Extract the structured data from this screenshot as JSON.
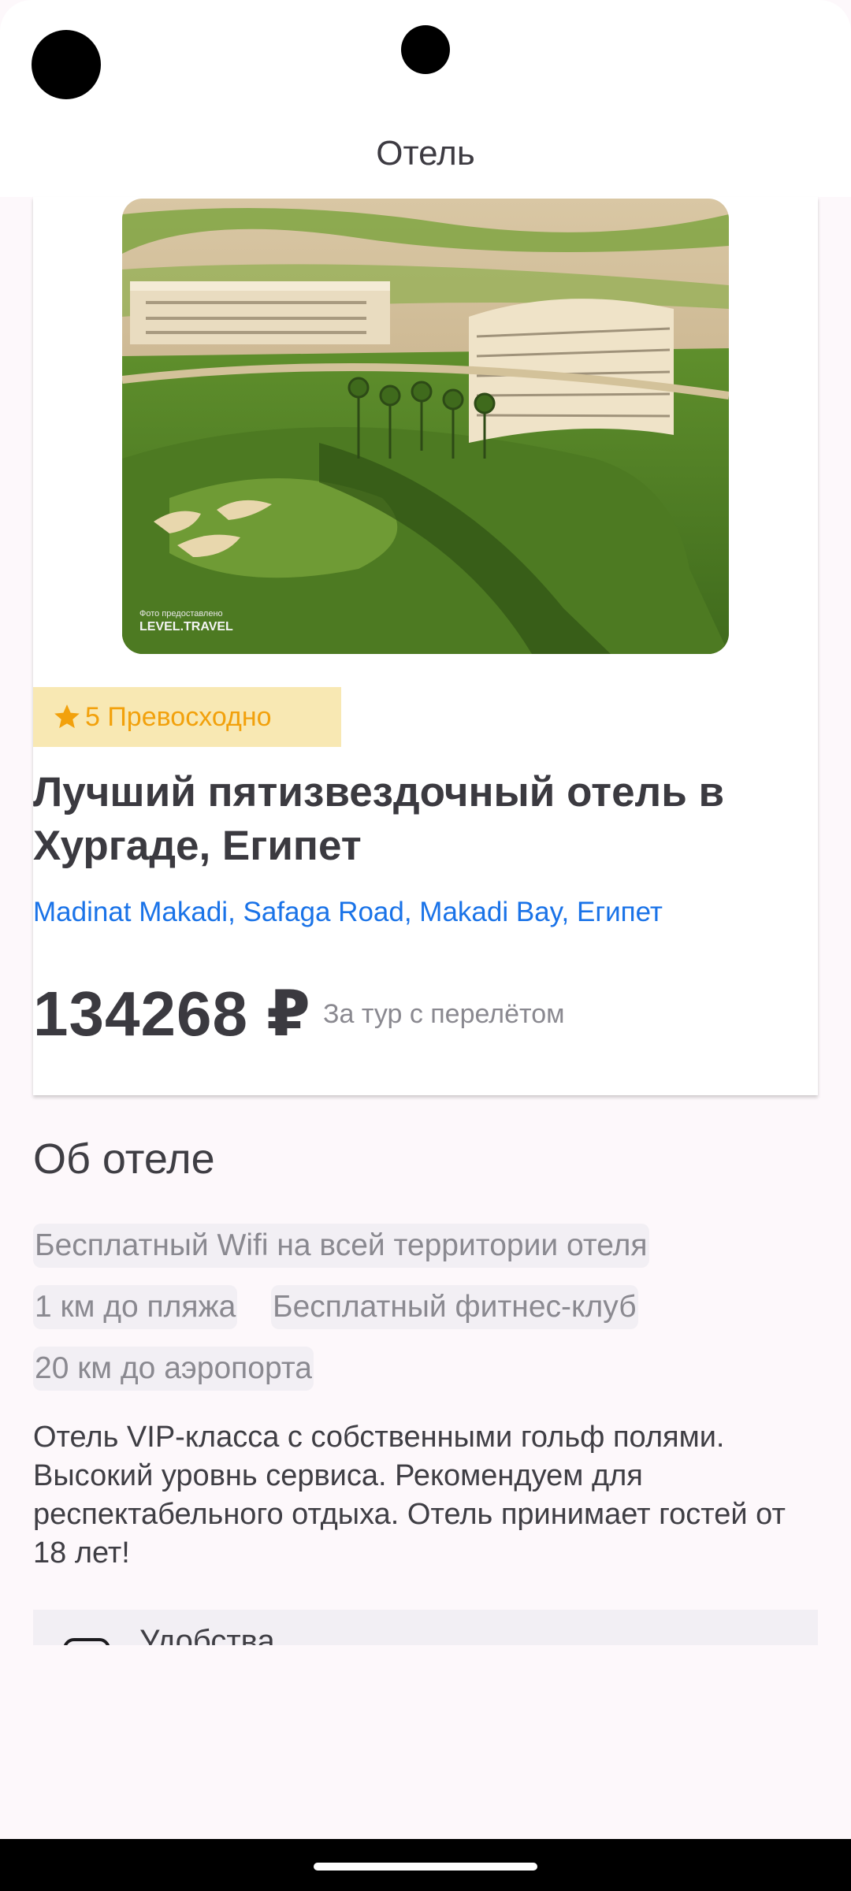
{
  "header": {
    "title": "Отель"
  },
  "hotel": {
    "rating_label": "5 Превосходно",
    "name": "Лучший пятизвездочный отель в Хургаде, Египет",
    "address": "Madinat Makadi, Safaga Road, Makadi Bay, Египет",
    "price": "134268 ₽",
    "price_note": "За тур с перелётом",
    "photo_caption_1": "Фото предоставлено",
    "photo_caption_2": "LEVEL.TRAVEL"
  },
  "about": {
    "title": "Об отеле",
    "features": [
      "Бесплатный Wifi на всей территории отеля",
      "1 км до пляжа",
      "Бесплатный фитнес-клуб",
      "20 км до аэропорта"
    ],
    "description": "Отель VIP-класса с собственными гольф полями. Высокий уровнь сервиса. Рекомендуем для респектабельного отдыха. Отель принимает гостей от 18 лет!"
  },
  "amenities": {
    "label": "Удобства"
  },
  "colors": {
    "accent_star": "#f2a10c",
    "badge_bg": "#f8e8b3",
    "link": "#1a73e8"
  }
}
